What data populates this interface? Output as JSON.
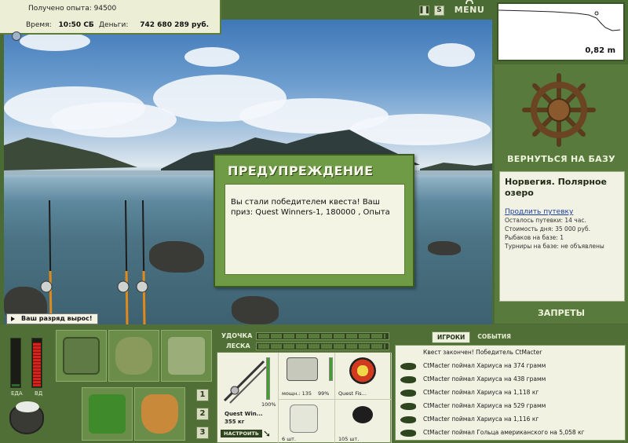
{
  "info": {
    "experience_label": "Получено опыта:",
    "experience_value": "94500",
    "time_label": "Время:",
    "time_value": "10:50 СБ",
    "money_label": "Деньги:",
    "money_value": "742 680 289 руб."
  },
  "topbar": {
    "pause_icon": "pause-icon",
    "sound_icon": "S",
    "menu_label": "MENU"
  },
  "depth": {
    "value": "0,82 m"
  },
  "dialog": {
    "title": "ПРЕДУПРЕЖДЕНИЕ",
    "message": "Вы стали победителем квеста! Ваш приз: Quest Winners-1, 180000 , Опыта"
  },
  "toast": {
    "text": "Ваш разряд вырос!"
  },
  "right_panel": {
    "return_label": "ВЕРНУТЬСЯ НА БАЗУ",
    "location": "Норвегия. Полярное озеро",
    "extend_link": "Продлить путевку",
    "lines": [
      "Осталось путевки: 14 час.",
      "Стоимость дня: 35 000 руб.",
      "Рыбаков на базе: 1",
      "Турниры на базе: не объявлены"
    ],
    "bans_label": "ЗАПРЕТЫ"
  },
  "status_bars": {
    "food_label": "ЕДА",
    "drink_label": "ВД",
    "food_level": 0.05,
    "drink_level": 0.9
  },
  "inventory_tabs": [
    "1",
    "2",
    "3"
  ],
  "tackle": {
    "rod_label": "УДОЧКА",
    "line_label": "ЛЕСКА",
    "rod_name": "Quest Win...",
    "rod_weight": "355 кг",
    "rod_percent": "100%",
    "reel_caption": "мощн.: 135",
    "reel_percent": "99%",
    "lure_caption": "Quest Fis...",
    "hook_caption": "6 шт.",
    "bait_caption": "105 шт.",
    "tune_button": "НАСТРОИТЬ"
  },
  "events": {
    "tabs": [
      "ИГРОКИ",
      "СОБЫТИЯ"
    ],
    "items": [
      "Квест закончен! Победитель CtMacter",
      "CtMacter поймал Хариуса на 374 грамм",
      "CtMacter поймал Хариуса на 438 грамм",
      "CtMacter поймал Хариуса на 1,118 кг",
      "CtMacter поймал Хариуса на 529 грамм",
      "CtMacter поймал Хариуса на 1,116 кг",
      "CtMacter поймал Гольца американского на 5,058 кг"
    ]
  },
  "colors": {
    "panel_green": "#587a3c",
    "dark_green": "#3d5a22",
    "cream": "#f1f2e4"
  }
}
